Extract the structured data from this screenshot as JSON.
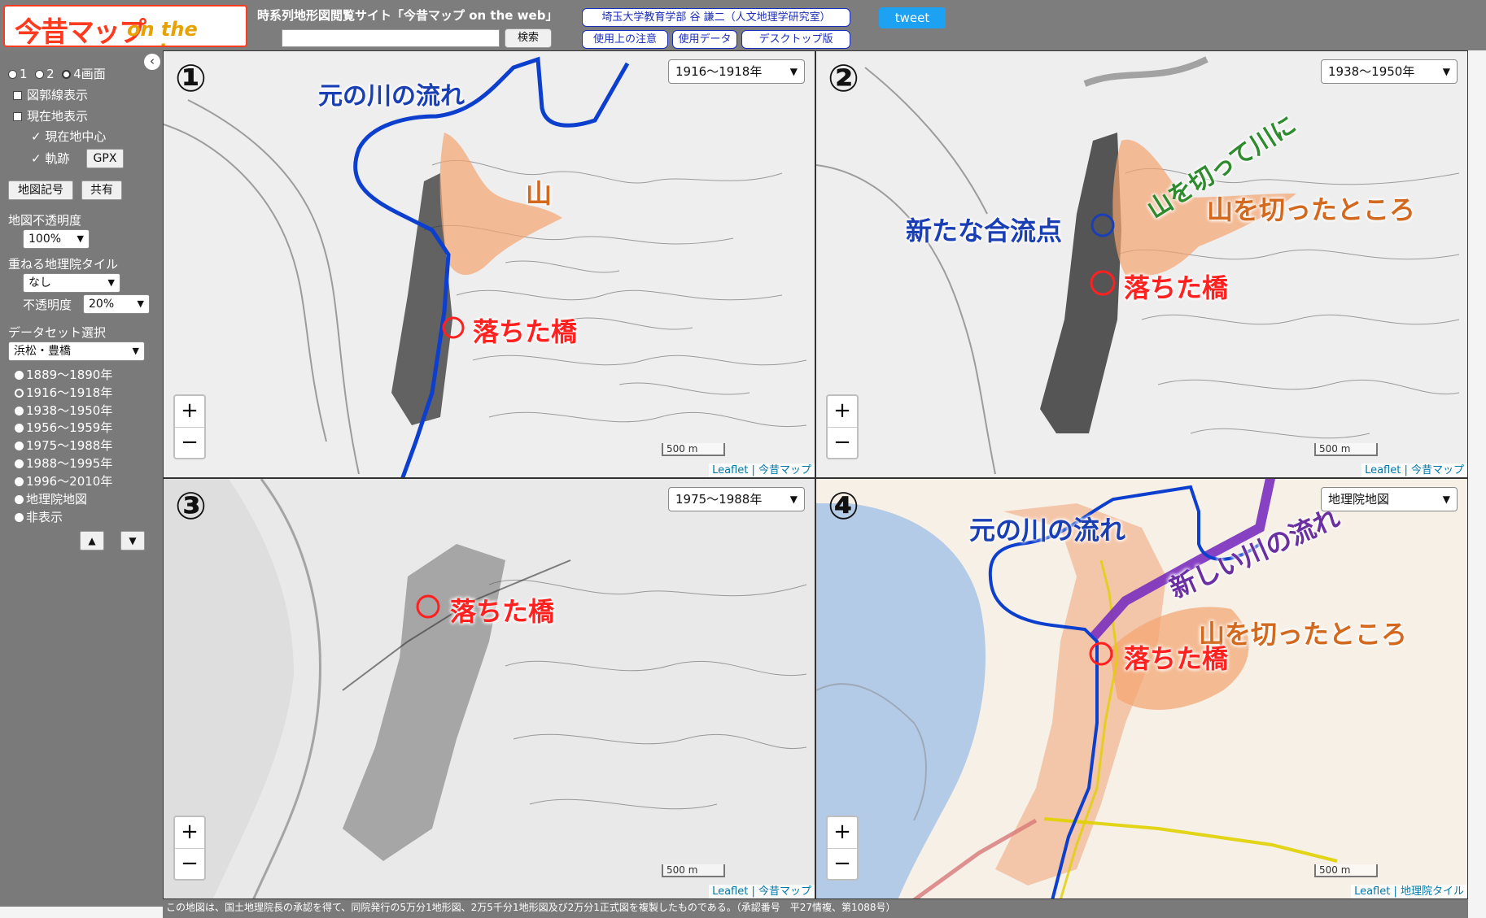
{
  "header": {
    "logo_jp": "今昔マップ",
    "logo_en": "on the web",
    "site_title": "時系列地形図閲覧サイト「今昔マップ on the web」",
    "search_button": "検索",
    "links": [
      "埼玉大学教育学部 谷 謙二（人文地理学研究室）",
      "使用上の注意",
      "使用データ",
      "デスクトップ版"
    ],
    "tweet": "tweet"
  },
  "sidebar": {
    "collapse_icon": "‹",
    "screens": [
      "1",
      "2",
      "4画面"
    ],
    "screens_selected": "4画面",
    "checkbox_zukaku": "図郭線表示",
    "checkbox_genzaichi": "現在地表示",
    "check_center": "現在地中心",
    "check_kiseki": "軌跡",
    "gpx_button": "GPX",
    "map_symbol_button": "地図記号",
    "share_button": "共有",
    "opacity_label": "地図不透明度",
    "opacity_value": "100%",
    "overlay_label": "重ねる地理院タイル",
    "overlay_value": "なし",
    "overlay_opacity_label": "不透明度",
    "overlay_opacity_value": "20%",
    "dataset_label": "データセット選択",
    "dataset_value": "浜松・豊橋",
    "periods": [
      "1889～1890年",
      "1916～1918年",
      "1938～1950年",
      "1956～1959年",
      "1975～1988年",
      "1988～1995年",
      "1996～2010年",
      "地理院地図",
      "非表示"
    ],
    "period_selected": "1916～1918年",
    "up_icon": "▲",
    "down_icon": "▼"
  },
  "maps": [
    {
      "number": "①",
      "year": "1916～1918年",
      "labels": {
        "old_river": "元の川の流れ",
        "mountain": "山",
        "bridge": "落ちた橋"
      },
      "attribution": "Leaflet | 今昔マップ",
      "scale": "500 m"
    },
    {
      "number": "②",
      "year": "1938～1950年",
      "labels": {
        "cut_mountain_river": "山を切って川に",
        "cut_place": "山を切ったところ",
        "new_confluence": "新たな合流点",
        "bridge": "落ちた橋"
      },
      "attribution": "Leaflet | 今昔マップ",
      "scale": "500 m"
    },
    {
      "number": "③",
      "year": "1975～1988年",
      "labels": {
        "bridge": "落ちた橋"
      },
      "attribution": "Leaflet | 今昔マップ",
      "scale": "500 m"
    },
    {
      "number": "④",
      "year": "地理院地図",
      "labels": {
        "old_river": "元の川の流れ",
        "new_river": "新しい川の流れ",
        "cut_place": "山を切ったところ",
        "bridge": "落ちた橋"
      },
      "attribution": "Leaflet | 地理院タイル",
      "scale": "500 m"
    }
  ],
  "zoom": {
    "in": "+",
    "out": "−"
  },
  "footer": "この地図は、国土地理院長の承認を得て、同院発行の5万分1地形図、2万5千分1地形図及び2万分1正式図を複製したものである。（承認番号　平27情複、第1088号）"
}
